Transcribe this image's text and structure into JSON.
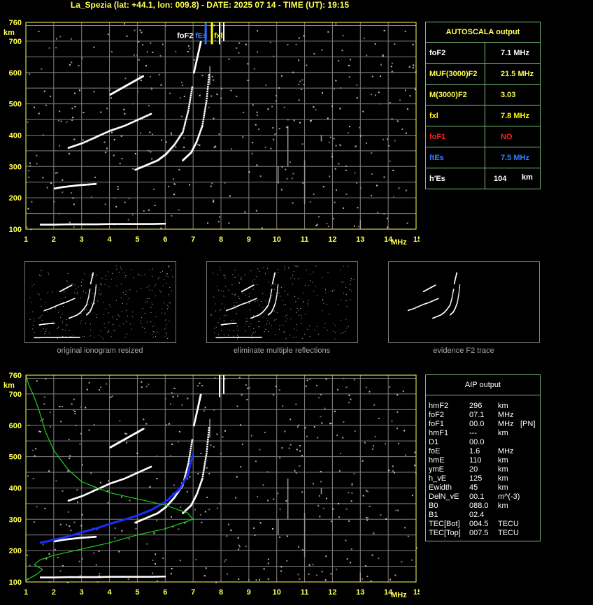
{
  "title": "La_Spezia (lat: +44.1, lon: 009.8) - DATE: 2025 07 14 - TIME (UT): 19:15",
  "axes": {
    "y_unit": "km",
    "x_unit": "MHz",
    "y_ticks": [
      "760",
      "700",
      "600",
      "500",
      "400",
      "300",
      "200",
      "100"
    ],
    "x_ticks": [
      "1",
      "2",
      "3",
      "4",
      "5",
      "6",
      "7",
      "8",
      "9",
      "10",
      "11",
      "12",
      "13",
      "14",
      "15"
    ]
  },
  "markers": {
    "fof2_label": "foF2",
    "fes_label": "fEs",
    "fxl_label": "fxl"
  },
  "colors": {
    "axis": "#ffff55",
    "grid": "#808080",
    "panel_border": "#7fbf7f",
    "fof2": "#2a6cff",
    "fxl": "#ffff00",
    "fof1": "#ff2020",
    "fes": "#3080ff",
    "profile": "#22cc22",
    "trace": "#1a2dff"
  },
  "autoscala": {
    "title": "AUTOSCALA output",
    "rows": [
      {
        "label": "foF2",
        "value": "7.1 MHz",
        "color": "#ffffff"
      },
      {
        "label": "MUF(3000)F2",
        "value": "21.5 MHz",
        "color": "#ffff55"
      },
      {
        "label": "M(3000)F2",
        "value": "3.03",
        "color": "#ffff55"
      },
      {
        "label": "fxl",
        "value": "7.8 MHz",
        "color": "#ffff00"
      },
      {
        "label": "foF1",
        "value": "NO",
        "color": "#ff2020"
      },
      {
        "label": "ftEs",
        "value": "7.5 MHz",
        "color": "#3080ff"
      },
      {
        "label": "h'Es",
        "value": "104",
        "unit": "km",
        "color": "#ffffff"
      }
    ]
  },
  "thumbnails": [
    {
      "caption": "original ionogram resized"
    },
    {
      "caption": "eliminate multiple reflections"
    },
    {
      "caption": "evidence F2 trace"
    }
  ],
  "aip": {
    "title": "AIP output",
    "rows": [
      {
        "label": "hmF2",
        "value": "296",
        "unit": "km",
        "extra": ""
      },
      {
        "label": "foF2",
        "value": "07.1",
        "unit": "MHz",
        "extra": ""
      },
      {
        "label": "foF1",
        "value": "00.0",
        "unit": "MHz",
        "extra": "[PN]"
      },
      {
        "label": "hmF1",
        "value": "---",
        "unit": "km",
        "extra": ""
      },
      {
        "label": "D1",
        "value": "00.0",
        "unit": "",
        "extra": ""
      },
      {
        "label": "foE",
        "value": "1.6",
        "unit": "MHz",
        "extra": ""
      },
      {
        "label": "hmE",
        "value": "110",
        "unit": "km",
        "extra": ""
      },
      {
        "label": "ymE",
        "value": "20",
        "unit": "km",
        "extra": ""
      },
      {
        "label": "h_vE",
        "value": "125",
        "unit": "km",
        "extra": ""
      },
      {
        "label": "Ewidth",
        "value": "45",
        "unit": "km",
        "extra": ""
      },
      {
        "label": "DelN_vE",
        "value": "00.1",
        "unit": "m^(-3)",
        "extra": ""
      },
      {
        "label": "B0",
        "value": "088.0",
        "unit": "km",
        "extra": ""
      },
      {
        "label": "B1",
        "value": "02.4",
        "unit": "",
        "extra": ""
      },
      {
        "label": "TEC[Bot]",
        "value": "004.5",
        "unit": "TECU",
        "extra": ""
      },
      {
        "label": "TEC[Top]",
        "value": "007.5",
        "unit": "TECU",
        "extra": ""
      }
    ]
  },
  "chart_data": [
    {
      "type": "scatter",
      "title": "",
      "xlabel": "MHz",
      "ylabel": "km",
      "xlim": [
        1,
        15
      ],
      "ylim": [
        100,
        760
      ],
      "grid": true,
      "markers": {
        "foF2": 7.1,
        "fEs": 7.5,
        "fxl": 7.8
      },
      "series": [
        {
          "name": "",
          "x": [
            1.5,
            2.0,
            2.5,
            3.0,
            3.5,
            4.0,
            4.5,
            5.0,
            5.5,
            6.0
          ],
          "y": [
            115,
            115,
            116,
            116,
            116,
            117,
            117,
            117,
            117,
            118
          ]
        },
        {
          "name": "",
          "x": [
            2.0,
            2.3,
            2.6,
            2.9,
            3.2,
            3.5
          ],
          "y": [
            230,
            235,
            238,
            241,
            243,
            245
          ]
        },
        {
          "name": "",
          "x": [
            2.5,
            3.0,
            3.5,
            4.0,
            4.5,
            5.0,
            5.5
          ],
          "y": [
            360,
            375,
            395,
            415,
            430,
            450,
            470
          ]
        },
        {
          "name": "",
          "x": [
            4.0,
            4.3,
            4.6,
            4.9,
            5.2
          ],
          "y": [
            530,
            545,
            560,
            575,
            590
          ]
        },
        {
          "name": "",
          "x": [
            4.9,
            5.3,
            5.7,
            6.0,
            6.3,
            6.6,
            6.8,
            6.95
          ],
          "y": [
            290,
            305,
            320,
            340,
            370,
            410,
            480,
            560
          ]
        },
        {
          "name": "",
          "x": [
            6.6,
            6.9,
            7.1,
            7.3,
            7.45,
            7.55
          ],
          "y": [
            320,
            345,
            380,
            430,
            510,
            600
          ]
        },
        {
          "name": "",
          "x": [
            7.0,
            7.1,
            7.2,
            7.25
          ],
          "y": [
            600,
            640,
            680,
            700
          ]
        }
      ]
    },
    {
      "type": "line",
      "title": "",
      "xlabel": "MHz",
      "ylabel": "km",
      "xlim": [
        1,
        15
      ],
      "ylim": [
        100,
        760
      ],
      "grid": true,
      "series": [
        {
          "name": "",
          "x": [
            1.5,
            1.7,
            2.0,
            2.5,
            3.0,
            3.5,
            4.0,
            4.5,
            5.0,
            5.5,
            6.0,
            6.5,
            6.8,
            7.0
          ],
          "y": [
            225,
            228,
            235,
            245,
            258,
            270,
            285,
            298,
            312,
            330,
            355,
            395,
            440,
            510
          ]
        },
        {
          "name": "",
          "x": [
            1.0,
            1.2,
            1.4,
            1.6,
            1.3,
            1.5,
            2.0,
            3.0,
            4.0,
            5.0,
            6.0,
            6.5,
            7.0,
            6.8,
            6.0,
            5.0,
            4.0,
            3.0,
            2.5,
            2.0,
            1.7,
            1.5,
            1.3,
            1.1,
            1.0
          ],
          "y": [
            105,
            115,
            125,
            140,
            155,
            170,
            185,
            205,
            225,
            250,
            270,
            285,
            300,
            320,
            345,
            365,
            385,
            420,
            460,
            520,
            580,
            640,
            690,
            730,
            760
          ]
        }
      ]
    }
  ]
}
